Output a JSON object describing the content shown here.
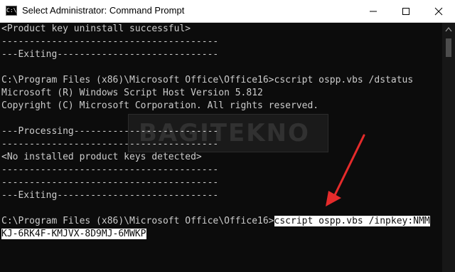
{
  "window": {
    "title": "Select Administrator: Command Prompt",
    "app_icon_text": "C:\\",
    "icons": {
      "app": "cmd-icon",
      "minimize": "minimize-icon",
      "maximize": "maximize-icon",
      "close": "close-icon"
    }
  },
  "console": {
    "lines": [
      "<Product key uninstall successful>",
      "---------------------------------------",
      "---Exiting-----------------------------",
      "",
      "C:\\Program Files (x86)\\Microsoft Office\\Office16>cscript ospp.vbs /dstatus",
      "Microsoft (R) Windows Script Host Version 5.812",
      "Copyright (C) Microsoft Corporation. All rights reserved.",
      "",
      "---Processing--------------------------",
      "---------------------------------------",
      "<No installed product keys detected>",
      "---------------------------------------",
      "---------------------------------------",
      "---Exiting-----------------------------",
      "",
      "C:\\Program Files (x86)\\Microsoft Office\\Office16>"
    ],
    "selected_command": "cscript ospp.vbs /inpkey:NMM",
    "selected_command_cont": "KJ-6RK4F-KMJVX-8D9MJ-6MWKP"
  },
  "watermark": {
    "text": "BAGITEKNO"
  },
  "annotation": {
    "arrow_color": "#e52b2b"
  },
  "colors": {
    "console_bg": "#0c0c0c",
    "console_fg": "#cccccc",
    "selection_bg": "#ffffff"
  }
}
